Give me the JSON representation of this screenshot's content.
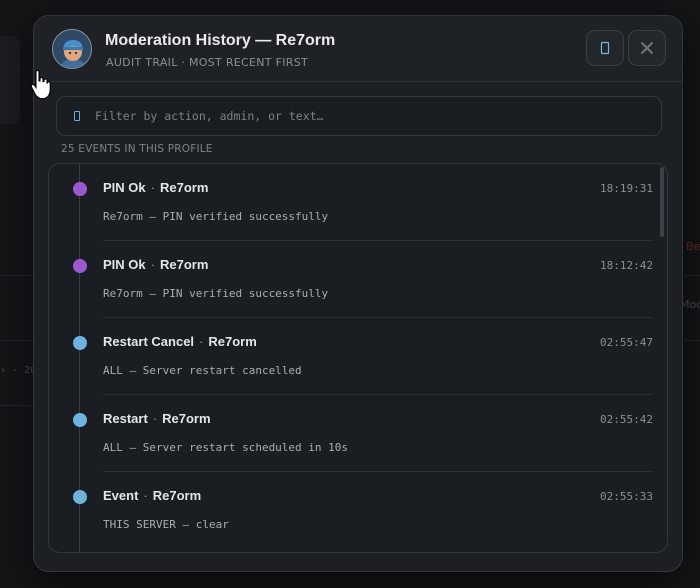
{
  "window": {
    "title": "Moderation History — Re7orm",
    "subtitle": "AUDIT TRAIL · MOST RECENT FIRST"
  },
  "header_buttons": {
    "copy_icon": "copy-icon",
    "close_icon": "close-icon"
  },
  "filter": {
    "placeholder": "Filter by action, admin, or text…",
    "value": ""
  },
  "count_label": "25 EVENTS IN THIS PROFILE",
  "colors": {
    "accent_purple": "#9b59d0",
    "accent_blue": "#6fb2dc"
  },
  "events": [
    {
      "action": "PIN Ok",
      "admin": "Re7orm",
      "time": "18:19:31",
      "description": "Re7orm — PIN verified successfully",
      "color": "#9b59d0"
    },
    {
      "action": "PIN Ok",
      "admin": "Re7orm",
      "time": "18:12:42",
      "description": "Re7orm — PIN verified successfully",
      "color": "#9b59d0"
    },
    {
      "action": "Restart Cancel",
      "admin": "Re7orm",
      "time": "02:55:47",
      "description": "ALL — Server restart cancelled",
      "color": "#6fb2dc"
    },
    {
      "action": "Restart",
      "admin": "Re7orm",
      "time": "02:55:42",
      "description": "ALL — Server restart scheduled in 10s",
      "color": "#6fb2dc"
    },
    {
      "action": "Event",
      "admin": "Re7orm",
      "time": "02:55:33",
      "description": "THIS SERVER — clear",
      "color": "#6fb2dc"
    }
  ],
  "background": {
    "left_text": "› · 20",
    "right_red_text": "Be",
    "right_gray_text": "Mod"
  }
}
